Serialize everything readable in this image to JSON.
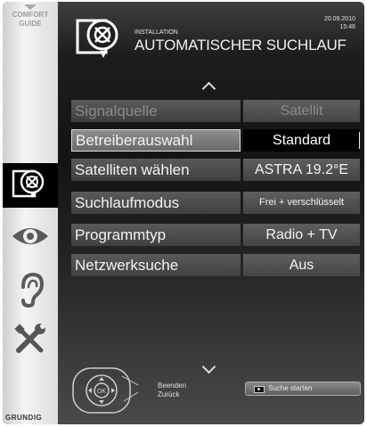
{
  "sidebar": {
    "guide_line1": "COMFORT",
    "guide_line2": "GUIDE",
    "items": [
      {
        "icon": "satellite-dish-icon",
        "selected": true
      },
      {
        "icon": "eye-icon",
        "selected": false
      },
      {
        "icon": "ear-icon",
        "selected": false
      },
      {
        "icon": "tools-icon",
        "selected": false
      }
    ],
    "brand": "GRUNDIG"
  },
  "header": {
    "date": "20.09.2010",
    "time": "15:46",
    "subtitle": "INSTALLATION",
    "title": "AUTOMATISCHER SUCHLAUF"
  },
  "menu": [
    {
      "label": "Signalquelle",
      "value": "Satellit",
      "state": "disabled"
    },
    {
      "label": "Betreiberauswahl",
      "value": "Standard",
      "state": "selected"
    },
    {
      "label": "Satelliten wählen",
      "value": "ASTRA 19.2°E",
      "state": "normal"
    },
    {
      "label": "Suchlaufmodus",
      "value": "Frei + verschlüsselt",
      "state": "normal"
    },
    {
      "label": "Programmtyp",
      "value": "Radio + TV",
      "state": "normal"
    },
    {
      "label": "Netzwerksuche",
      "value": "Aus",
      "state": "normal"
    }
  ],
  "footer": {
    "ok_label": "OK",
    "exit_label": "Beenden",
    "back_label": "Zurück",
    "start_button": "Suche starten"
  },
  "colors": {
    "accent_text": "#f2f2f2",
    "selected_value_bg": "#000000"
  }
}
